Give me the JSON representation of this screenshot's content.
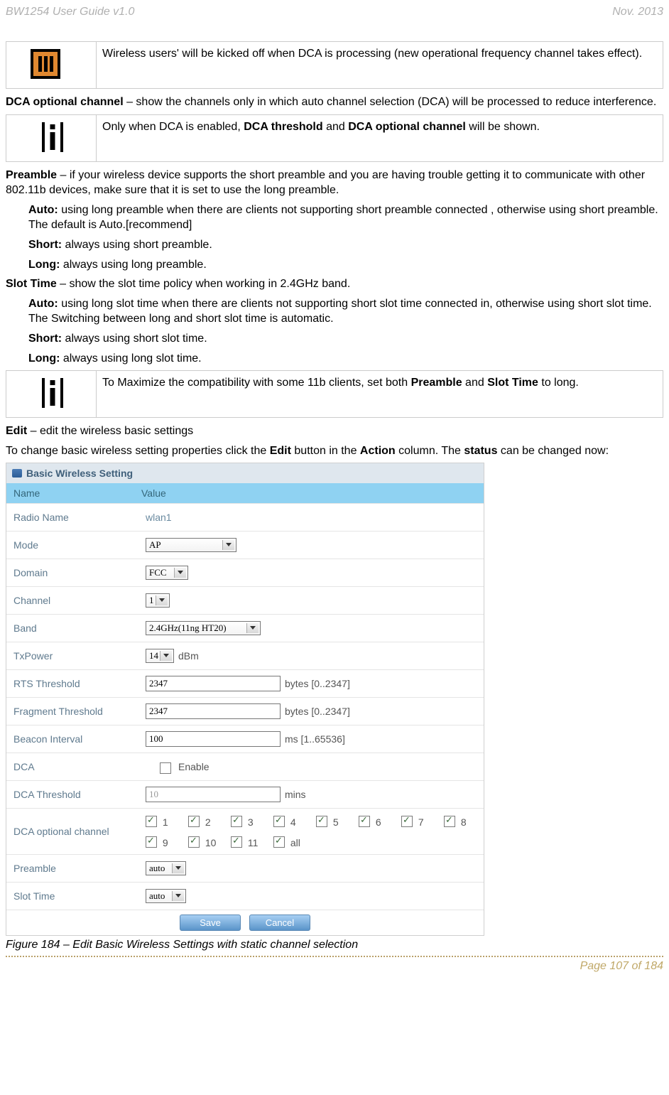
{
  "header": {
    "left": "BW1254 User Guide v1.0",
    "right": "Nov.  2013"
  },
  "notes": {
    "warn_dca": "Wireless users' will be kicked off when DCA is processing (new operational frequency channel takes effect).",
    "info_dca_shown_pre": "Only when DCA is enabled, ",
    "info_dca_shown_b1": "DCA threshold",
    "info_dca_shown_mid": " and ",
    "info_dca_shown_b2": "DCA optional channel",
    "info_dca_shown_post": " will be shown.",
    "info_compat_pre": "To Maximize the compatibility with some 11b clients, set both ",
    "info_compat_b1": "Preamble",
    "info_compat_mid": " and ",
    "info_compat_b2": "Slot Time",
    "info_compat_post": " to long."
  },
  "paragraphs": {
    "dca_opt_label": "DCA optional channel",
    "dca_opt_rest": " – show the channels only in which auto channel selection (DCA) will be processed to reduce interference.",
    "preamble_label": "Preamble",
    "preamble_rest": " – if your wireless device supports the short preamble and you are having trouble getting it to communicate with other 802.11b devices, make sure that it is set to use the long preamble.",
    "preamble_auto_b": "Auto:",
    "preamble_auto": " using long preamble when there are clients not supporting short preamble connected , otherwise using short preamble. The default is Auto.[recommend]",
    "preamble_short_b": "Short:",
    "preamble_short": " always using short preamble.",
    "preamble_long_b": "Long:",
    "preamble_long": " always using long preamble.",
    "slot_label": "Slot Time",
    "slot_rest": " – show the slot time policy when working in 2.4GHz band.",
    "slot_auto_b": "Auto:",
    "slot_auto": " using long slot time when there are clients not supporting short slot time connected in, otherwise using short slot time. The Switching between long and short slot time is automatic.",
    "slot_short_b": "Short:",
    "slot_short": " always using short slot time.",
    "slot_long_b": "Long:",
    "slot_long": " always using long slot time.",
    "edit_label": "Edit",
    "edit_rest": " – edit the wireless basic settings",
    "change_pre": "To change basic wireless setting properties click the ",
    "change_b1": "Edit",
    "change_mid1": " button in the ",
    "change_b2": "Action",
    "change_mid2": " column. The ",
    "change_b3": "status",
    "change_post": " can be changed now:"
  },
  "fig": {
    "title": "Basic Wireless Setting",
    "col_name": "Name",
    "col_value": "Value",
    "rows": {
      "radio_name": {
        "label": "Radio Name",
        "value": "wlan1"
      },
      "mode": {
        "label": "Mode",
        "value": "AP"
      },
      "domain": {
        "label": "Domain",
        "value": "FCC"
      },
      "channel": {
        "label": "Channel",
        "value": "1"
      },
      "band": {
        "label": "Band",
        "value": "2.4GHz(11ng HT20)"
      },
      "txpower": {
        "label": "TxPower",
        "value": "14",
        "suffix": "dBm"
      },
      "rts": {
        "label": "RTS Threshold",
        "value": "2347",
        "suffix": "bytes [0..2347]"
      },
      "frag": {
        "label": "Fragment Threshold",
        "value": "2347",
        "suffix": "bytes [0..2347]"
      },
      "beacon": {
        "label": "Beacon Interval",
        "value": "100",
        "suffix": "ms [1..65536]"
      },
      "dca": {
        "label": "DCA",
        "check_label": "Enable"
      },
      "dca_thresh": {
        "label": "DCA Threshold",
        "value": "10",
        "suffix": "mins"
      },
      "dca_opt": {
        "label": "DCA optional channel"
      },
      "preamble": {
        "label": "Preamble",
        "value": "auto"
      },
      "slot": {
        "label": "Slot Time",
        "value": "auto"
      }
    },
    "channels": [
      "1",
      "2",
      "3",
      "4",
      "5",
      "6",
      "7",
      "8",
      "9",
      "10",
      "11",
      "all"
    ],
    "btn_save": "Save",
    "btn_cancel": "Cancel"
  },
  "caption": "Figure 184 – Edit Basic Wireless Settings with static channel selection",
  "footer": "Page 107 of 184"
}
